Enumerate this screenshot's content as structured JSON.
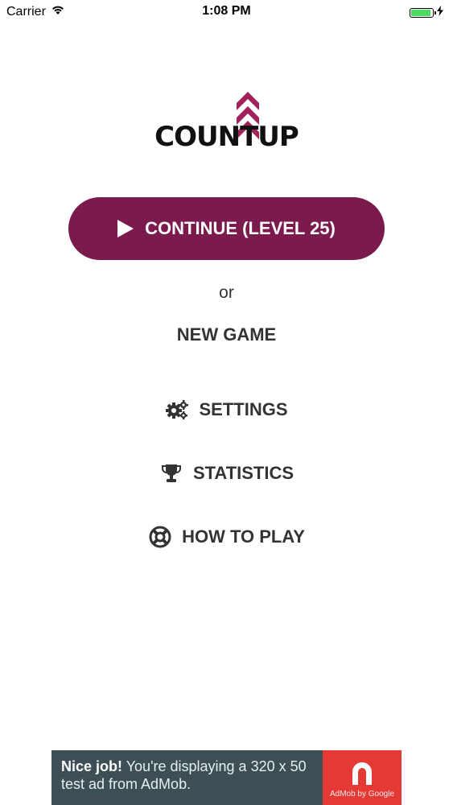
{
  "status_bar": {
    "carrier": "Carrier",
    "time": "1:08 PM",
    "wifi_icon": "wifi-icon",
    "battery_icon": "battery-icon",
    "charging_icon": "charging-bolt-icon"
  },
  "logo": {
    "text": "COUNTUP",
    "arrow_color": "#a3215b"
  },
  "continue_button": {
    "label": "CONTINUE (LEVEL 25)",
    "icon": "play-icon",
    "color": "#7b1a4c"
  },
  "or_text": "or",
  "new_game": {
    "label": "NEW GAME"
  },
  "menu": {
    "settings": {
      "label": "SETTINGS",
      "icon": "gears-icon"
    },
    "statistics": {
      "label": "STATISTICS",
      "icon": "trophy-icon"
    },
    "howto": {
      "label": "HOW TO PLAY",
      "icon": "lifebuoy-icon"
    }
  },
  "ad": {
    "headline": "Nice job!",
    "body": " You're displaying a 320 x 50 test ad from AdMob.",
    "brand": "AdMob by Google",
    "logo_icon": "admob-logo-icon",
    "background": "#3c4f55",
    "logo_bg": "#e53935"
  }
}
